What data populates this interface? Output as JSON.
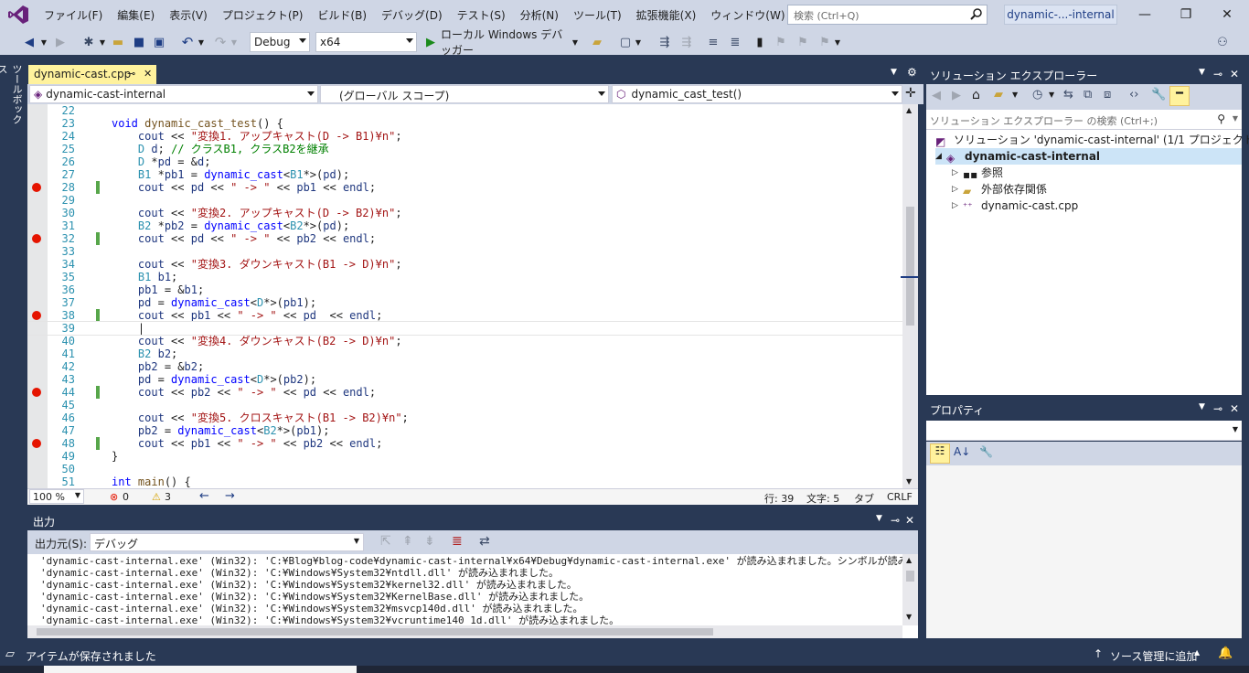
{
  "menu": {
    "items": [
      "ファイル(F)",
      "編集(E)",
      "表示(V)",
      "プロジェクト(P)",
      "ビルド(B)",
      "デバッグ(D)",
      "テスト(S)",
      "分析(N)",
      "ツール(T)",
      "拡張機能(X)",
      "ウィンドウ(W)",
      "ヘルプ(H)"
    ],
    "search_placeholder": "検索 (Ctrl+Q)",
    "solution_name": "dynamic-...-internal"
  },
  "toolbar": {
    "config": "Debug",
    "platform": "x64",
    "debug_target": "ローカル Windows デバッガー"
  },
  "toolbox_label": "ツールボックス",
  "editor": {
    "tab": "dynamic-cast.cpp",
    "tab_pin": "⊸",
    "tab_close": "✕",
    "nav_project": "dynamic-cast-internal",
    "nav_scope": "(グローバル スコープ)",
    "nav_function": "dynamic_cast_test()",
    "lines": [
      {
        "n": "22",
        "bp": false,
        "chg": false,
        "code": ""
      },
      {
        "n": "23",
        "bp": false,
        "chg": false,
        "code": "void dynamic_cast_test() {"
      },
      {
        "n": "24",
        "bp": false,
        "chg": false,
        "code": "    cout << \"変換1. アップキャスト(D -> B1)¥n\";"
      },
      {
        "n": "25",
        "bp": false,
        "chg": false,
        "code": "    D d; // クラスB1, クラスB2を継承"
      },
      {
        "n": "26",
        "bp": false,
        "chg": false,
        "code": "    D *pd = &d;"
      },
      {
        "n": "27",
        "bp": false,
        "chg": false,
        "code": "    B1 *pb1 = dynamic_cast<B1*>(pd);"
      },
      {
        "n": "28",
        "bp": true,
        "chg": true,
        "code": "    cout << pd << \" -> \" << pb1 << endl;"
      },
      {
        "n": "29",
        "bp": false,
        "chg": false,
        "code": ""
      },
      {
        "n": "30",
        "bp": false,
        "chg": false,
        "code": "    cout << \"変換2. アップキャスト(D -> B2)¥n\";"
      },
      {
        "n": "31",
        "bp": false,
        "chg": false,
        "code": "    B2 *pb2 = dynamic_cast<B2*>(pd);"
      },
      {
        "n": "32",
        "bp": true,
        "chg": true,
        "code": "    cout << pd << \" -> \" << pb2 << endl;"
      },
      {
        "n": "33",
        "bp": false,
        "chg": false,
        "code": ""
      },
      {
        "n": "34",
        "bp": false,
        "chg": false,
        "code": "    cout << \"変換3. ダウンキャスト(B1 -> D)¥n\";"
      },
      {
        "n": "35",
        "bp": false,
        "chg": false,
        "code": "    B1 b1;"
      },
      {
        "n": "36",
        "bp": false,
        "chg": false,
        "code": "    pb1 = &b1;"
      },
      {
        "n": "37",
        "bp": false,
        "chg": false,
        "code": "    pd = dynamic_cast<D*>(pb1);"
      },
      {
        "n": "38",
        "bp": true,
        "chg": true,
        "code": "    cout << pb1 << \" -> \" << pd  << endl;"
      },
      {
        "n": "39",
        "bp": false,
        "chg": false,
        "code": "    |"
      },
      {
        "n": "40",
        "bp": false,
        "chg": false,
        "code": "    cout << \"変換4. ダウンキャスト(B2 -> D)¥n\";"
      },
      {
        "n": "41",
        "bp": false,
        "chg": false,
        "code": "    B2 b2;"
      },
      {
        "n": "42",
        "bp": false,
        "chg": false,
        "code": "    pb2 = &b2;"
      },
      {
        "n": "43",
        "bp": false,
        "chg": false,
        "code": "    pd = dynamic_cast<D*>(pb2);"
      },
      {
        "n": "44",
        "bp": true,
        "chg": true,
        "code": "    cout << pb2 << \" -> \" << pd << endl;"
      },
      {
        "n": "45",
        "bp": false,
        "chg": false,
        "code": ""
      },
      {
        "n": "46",
        "bp": false,
        "chg": false,
        "code": "    cout << \"変換5. クロスキャスト(B1 -> B2)¥n\";"
      },
      {
        "n": "47",
        "bp": false,
        "chg": false,
        "code": "    pb2 = dynamic_cast<B2*>(pb1);"
      },
      {
        "n": "48",
        "bp": true,
        "chg": true,
        "code": "    cout << pb1 << \" -> \" << pb2 << endl;"
      },
      {
        "n": "49",
        "bp": false,
        "chg": false,
        "code": "}"
      },
      {
        "n": "50",
        "bp": false,
        "chg": false,
        "code": ""
      },
      {
        "n": "51",
        "bp": false,
        "chg": false,
        "code": "int main() {"
      }
    ],
    "zoom": "100 %",
    "errors": "0",
    "warnings": "3",
    "row": "行: 39",
    "col": "文字: 5",
    "tab_mode": "タブ",
    "line_ending": "CRLF"
  },
  "output": {
    "title": "出力",
    "source_label": "出力元(S):",
    "source_value": "デバッグ",
    "lines": [
      "'dynamic-cast-internal.exe' (Win32): 'C:¥Blog¥blog-code¥dynamic-cast-internal¥x64¥Debug¥dynamic-cast-internal.exe' が読み込まれました。シンボルが読み込まれま",
      "'dynamic-cast-internal.exe' (Win32): 'C:¥Windows¥System32¥ntdll.dll' が読み込まれました。",
      "'dynamic-cast-internal.exe' (Win32): 'C:¥Windows¥System32¥kernel32.dll' が読み込まれました。",
      "'dynamic-cast-internal.exe' (Win32): 'C:¥Windows¥System32¥KernelBase.dll' が読み込まれました。",
      "'dynamic-cast-internal.exe' (Win32): 'C:¥Windows¥System32¥msvcp140d.dll' が読み込まれました。",
      "'dynamic-cast-internal.exe' (Win32): 'C:¥Windows¥System32¥vcruntime140_1d.dll' が読み込まれました。"
    ]
  },
  "solution_explorer": {
    "title": "ソリューション エクスプローラー",
    "search_placeholder": "ソリューション エクスプローラー の検索 (Ctrl+;)",
    "solution": "ソリューション 'dynamic-cast-internal' (1/1 プロジェクト)",
    "project": "dynamic-cast-internal",
    "references": "参照",
    "external_deps": "外部依存関係",
    "file": "dynamic-cast.cpp"
  },
  "properties": {
    "title": "プロパティ"
  },
  "status": {
    "message": "アイテムが保存されました",
    "source_control": "ソース管理に追加"
  },
  "colors": {
    "accent": "#68217a",
    "chrome": "#cfd6e5",
    "panel_header": "#293955",
    "tab_active": "#fff29d",
    "breakpoint": "#e51400"
  }
}
